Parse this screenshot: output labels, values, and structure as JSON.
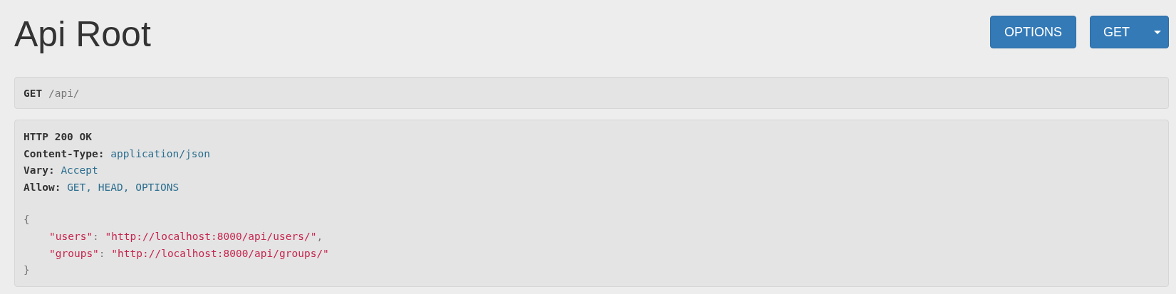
{
  "title": "Api Root",
  "buttons": [
    {
      "label": "OPTIONS",
      "kind": "plain"
    },
    {
      "label": "GET",
      "kind": "dropdown"
    }
  ],
  "request": {
    "method": "GET",
    "path": "/api/"
  },
  "response": {
    "status_line": "HTTP 200 OK",
    "headers": [
      {
        "name": "Content-Type:",
        "value": "application/json"
      },
      {
        "name": "Vary:",
        "value": "Accept"
      },
      {
        "name": "Allow:",
        "value": "GET, HEAD, OPTIONS"
      }
    ],
    "body": {
      "open": "{",
      "close": "}",
      "entries": [
        {
          "key": "\"users\"",
          "separator": ":",
          "value": "\"http://localhost:8000/api/users/\"",
          "end": ","
        },
        {
          "key": "\"groups\"",
          "separator": ":",
          "value": "\"http://localhost:8000/api/groups/\""
        }
      ]
    }
  }
}
